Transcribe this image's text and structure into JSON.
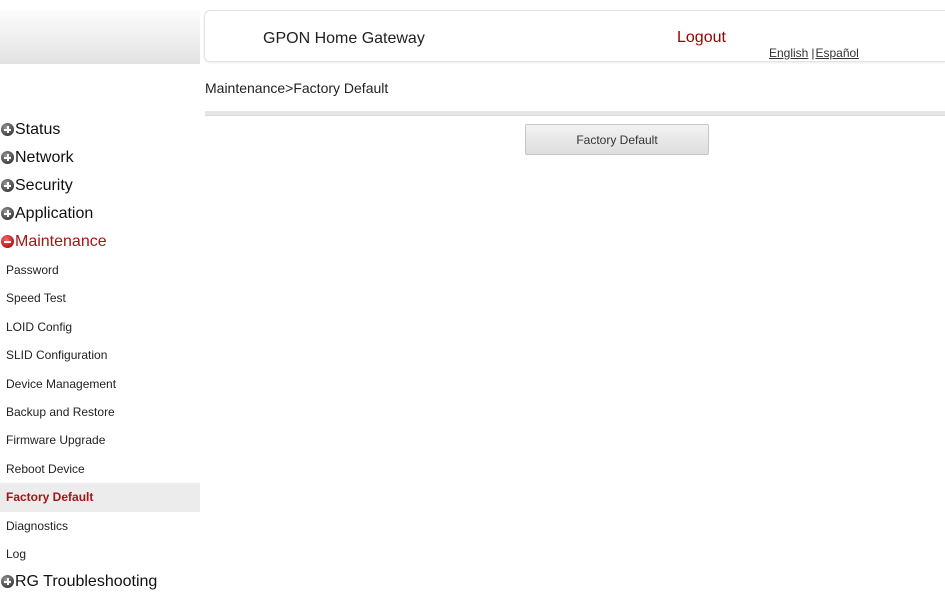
{
  "header": {
    "title": "GPON Home Gateway",
    "logout_label": "Logout",
    "languages": [
      "English",
      "Español"
    ],
    "lang_separator": "|"
  },
  "breadcrumb": "Maintenance>Factory Default",
  "main": {
    "factory_default_button": "Factory Default"
  },
  "sidebar": {
    "menus": [
      {
        "label": "Status",
        "state": "collapsed",
        "icon": "plus-circle-icon"
      },
      {
        "label": "Network",
        "state": "collapsed",
        "icon": "plus-circle-icon"
      },
      {
        "label": "Security",
        "state": "collapsed",
        "icon": "plus-circle-icon"
      },
      {
        "label": "Application",
        "state": "collapsed",
        "icon": "plus-circle-icon"
      },
      {
        "label": "Maintenance",
        "state": "expanded",
        "icon": "minus-circle-icon"
      },
      {
        "label": "RG Troubleshooting",
        "state": "collapsed",
        "icon": "plus-circle-icon"
      }
    ],
    "maintenance_items": [
      {
        "label": "Password"
      },
      {
        "label": "Speed Test"
      },
      {
        "label": "LOID Config"
      },
      {
        "label": "SLID Configuration"
      },
      {
        "label": "Device Management"
      },
      {
        "label": "Backup and Restore"
      },
      {
        "label": "Firmware Upgrade"
      },
      {
        "label": "Reboot Device"
      },
      {
        "label": "Factory Default",
        "active": true
      },
      {
        "label": "Diagnostics"
      },
      {
        "label": "Log"
      }
    ]
  },
  "colors": {
    "accent_red": "#a31515",
    "logout_red": "#990000",
    "active_item_bg": "#ececec"
  }
}
